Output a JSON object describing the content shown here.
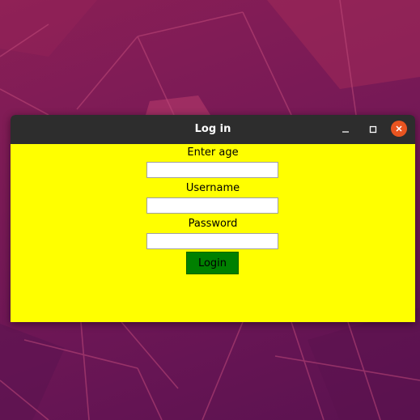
{
  "window": {
    "title": "Log in",
    "controls": {
      "minimize_icon": "minimize-icon",
      "maximize_icon": "maximize-icon",
      "close_icon": "close-icon"
    }
  },
  "form": {
    "age_label": "Enter age",
    "age_value": "",
    "username_label": "Username",
    "username_value": "",
    "password_label": "Password",
    "password_value": "",
    "login_label": "Login"
  },
  "colors": {
    "client_background": "#ffff00",
    "login_button": "#008000",
    "titlebar": "#2d2d2d",
    "close_button": "#e95420",
    "desktop": "#7a1a56"
  }
}
